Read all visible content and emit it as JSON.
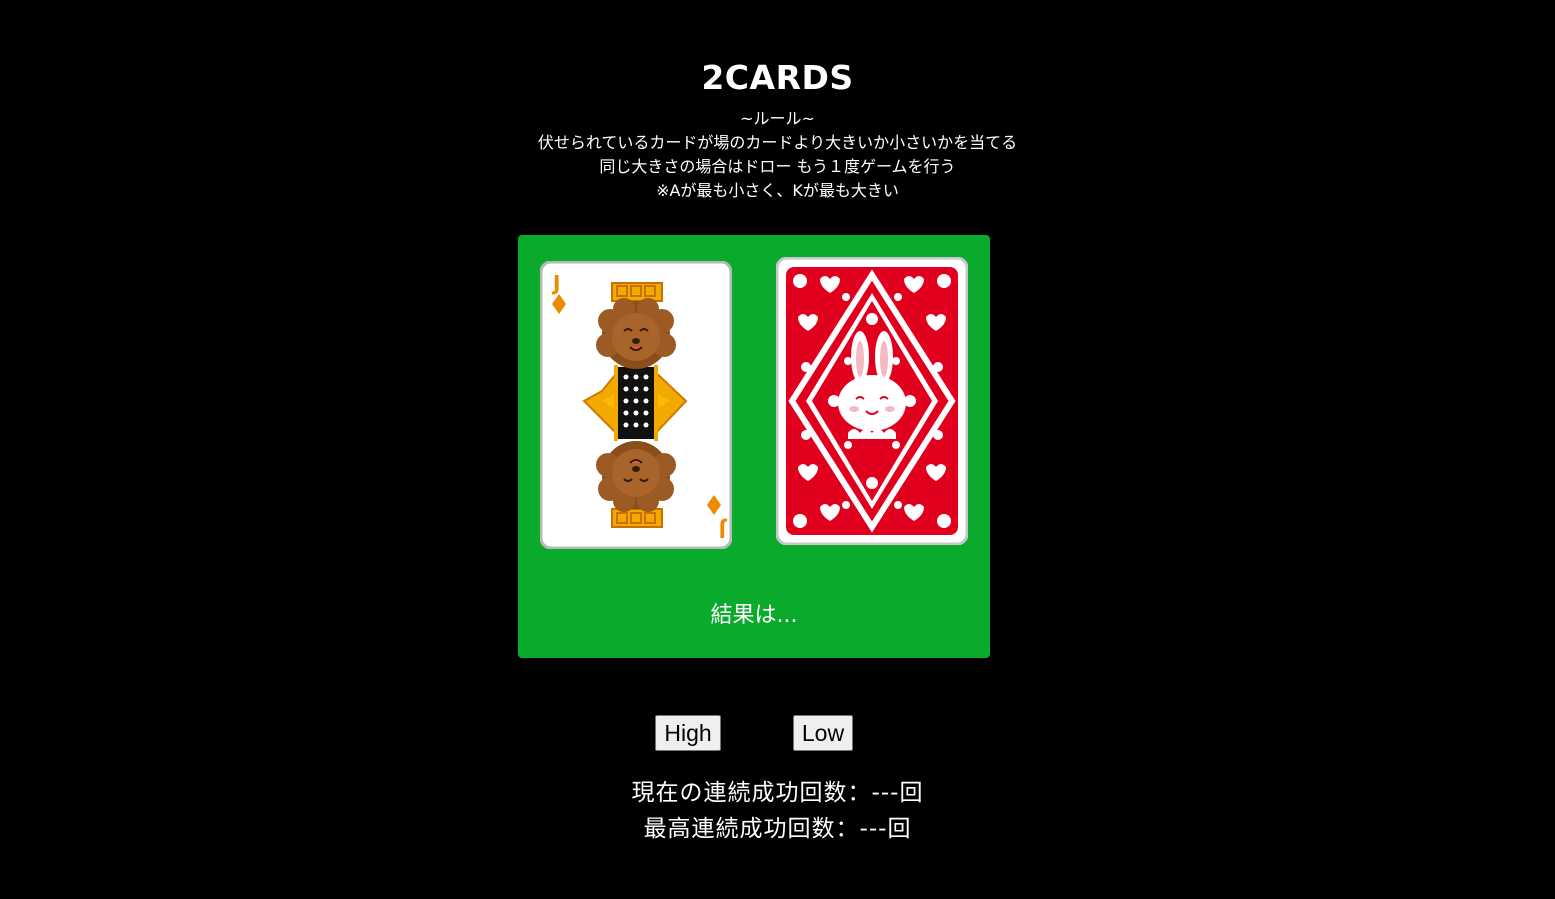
{
  "title": "2CARDS",
  "rules": {
    "heading": "~ルール~",
    "line1": "伏せられているカードが場のカードより大きいか小さいかを当てる",
    "line2": "同じ大きさの場合はドロー もう１度ゲームを行う",
    "line3": "※Aが最も小さく、Kが最も大きい"
  },
  "table": {
    "face_card": {
      "rank": "J",
      "suit": "diamond",
      "figure": "dog-jack-icon"
    },
    "back_card": {
      "figure": "rabbit-card-back-icon"
    },
    "result_text": "結果は..."
  },
  "buttons": {
    "high_label": "High",
    "low_label": "Low"
  },
  "stats": {
    "current_streak": "現在の連続成功回数：---回",
    "best_streak": "最高連続成功回数：---回"
  },
  "colors": {
    "background": "#000000",
    "table": "#0aab2c",
    "card_back_red": "#e0001e",
    "suit_orange": "#ee8c00"
  }
}
